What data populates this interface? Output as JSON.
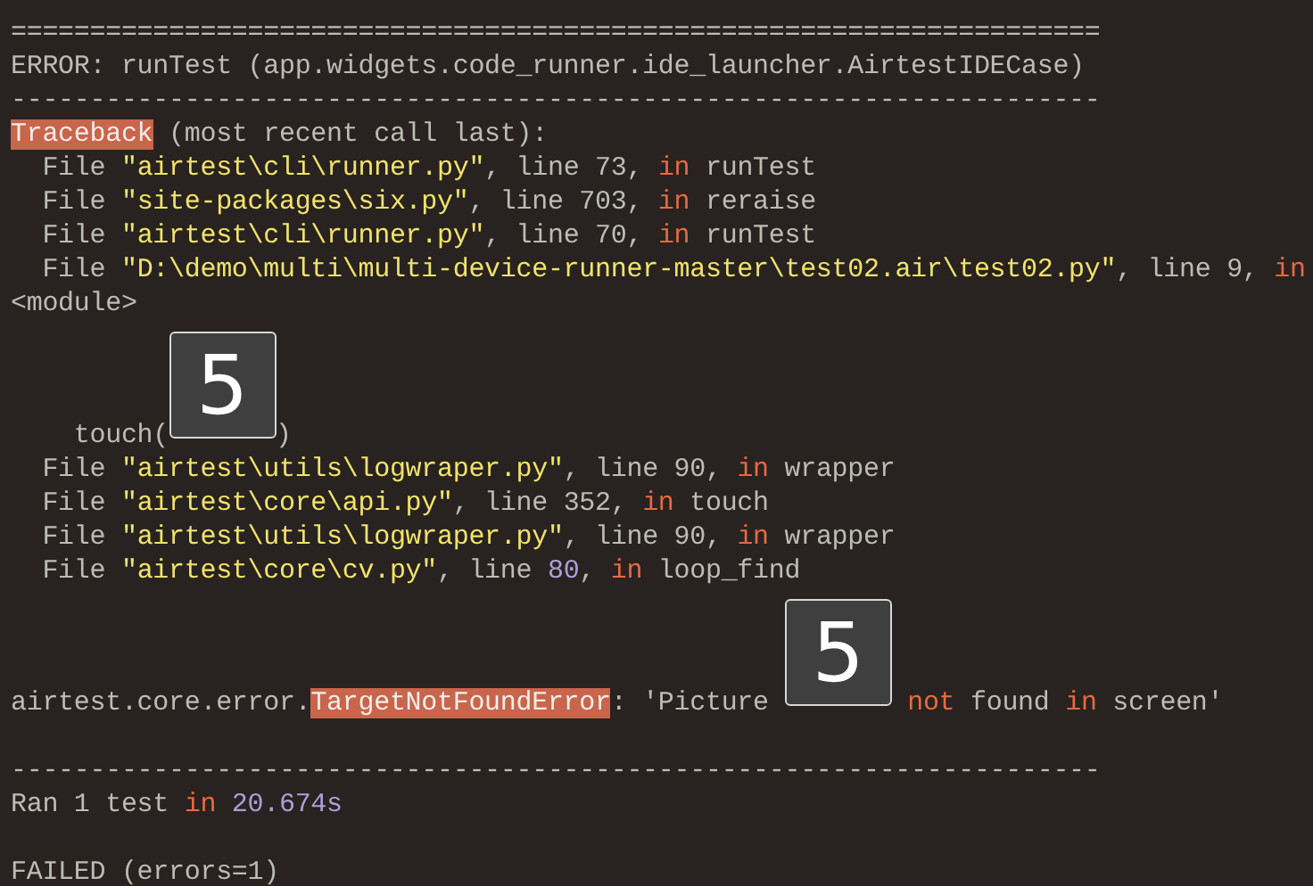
{
  "lines": [
    {
      "kind": "text",
      "segments": [
        {
          "kind": "plain",
          "text": "====================================================================="
        }
      ]
    },
    {
      "kind": "text",
      "segments": [
        {
          "kind": "plain",
          "text": "ERROR: runTest (app.widgets.code_runner.ide_launcher.AirtestIDECase)"
        }
      ]
    },
    {
      "kind": "text",
      "segments": [
        {
          "kind": "plain",
          "text": "---------------------------------------------------------------------"
        }
      ]
    },
    {
      "kind": "text",
      "segments": [
        {
          "kind": "highlight",
          "text": "Traceback"
        },
        {
          "kind": "plain",
          "text": " (most recent call last):"
        }
      ]
    },
    {
      "kind": "text",
      "segments": [
        {
          "kind": "plain",
          "text": "  File "
        },
        {
          "kind": "string",
          "text": "\"airtest\\cli\\runner.py\""
        },
        {
          "kind": "plain",
          "text": ", line 73, "
        },
        {
          "kind": "keyword",
          "text": "in"
        },
        {
          "kind": "plain",
          "text": " runTest"
        }
      ]
    },
    {
      "kind": "text",
      "segments": [
        {
          "kind": "plain",
          "text": "  File "
        },
        {
          "kind": "string",
          "text": "\"site-packages\\six.py\""
        },
        {
          "kind": "plain",
          "text": ", line 703, "
        },
        {
          "kind": "keyword",
          "text": "in"
        },
        {
          "kind": "plain",
          "text": " reraise"
        }
      ]
    },
    {
      "kind": "text",
      "segments": [
        {
          "kind": "plain",
          "text": "  File "
        },
        {
          "kind": "string",
          "text": "\"airtest\\cli\\runner.py\""
        },
        {
          "kind": "plain",
          "text": ", line 70, "
        },
        {
          "kind": "keyword",
          "text": "in"
        },
        {
          "kind": "plain",
          "text": " runTest"
        }
      ]
    },
    {
      "kind": "text",
      "segments": [
        {
          "kind": "plain",
          "text": "  File "
        },
        {
          "kind": "string",
          "text": "\"D:\\demo\\multi\\multi-device-runner-master\\test02.air\\test02.py\""
        },
        {
          "kind": "plain",
          "text": ", line 9, "
        },
        {
          "kind": "keyword",
          "text": "in"
        }
      ]
    },
    {
      "kind": "text",
      "segments": [
        {
          "kind": "plain",
          "text": "<module>"
        }
      ]
    },
    {
      "kind": "text",
      "segments": [
        {
          "kind": "plain",
          "text": "    touch("
        },
        {
          "kind": "image",
          "text": "5"
        },
        {
          "kind": "plain",
          "text": ")"
        }
      ]
    },
    {
      "kind": "text",
      "segments": [
        {
          "kind": "plain",
          "text": "  File "
        },
        {
          "kind": "string",
          "text": "\"airtest\\utils\\logwraper.py\""
        },
        {
          "kind": "plain",
          "text": ", line 90, "
        },
        {
          "kind": "keyword",
          "text": "in"
        },
        {
          "kind": "plain",
          "text": " wrapper"
        }
      ]
    },
    {
      "kind": "text",
      "segments": [
        {
          "kind": "plain",
          "text": "  File "
        },
        {
          "kind": "string",
          "text": "\"airtest\\core\\api.py\""
        },
        {
          "kind": "plain",
          "text": ", line 352, "
        },
        {
          "kind": "keyword",
          "text": "in"
        },
        {
          "kind": "plain",
          "text": " touch"
        }
      ]
    },
    {
      "kind": "text",
      "segments": [
        {
          "kind": "plain",
          "text": "  File "
        },
        {
          "kind": "string",
          "text": "\"airtest\\utils\\logwraper.py\""
        },
        {
          "kind": "plain",
          "text": ", line 90, "
        },
        {
          "kind": "keyword",
          "text": "in"
        },
        {
          "kind": "plain",
          "text": " wrapper"
        }
      ]
    },
    {
      "kind": "text",
      "segments": [
        {
          "kind": "plain",
          "text": "  File "
        },
        {
          "kind": "string",
          "text": "\"airtest\\core\\cv.py\""
        },
        {
          "kind": "plain",
          "text": ", line "
        },
        {
          "kind": "number",
          "text": "80"
        },
        {
          "kind": "plain",
          "text": ", "
        },
        {
          "kind": "keyword",
          "text": "in"
        },
        {
          "kind": "plain",
          "text": " loop_find"
        }
      ]
    },
    {
      "kind": "text",
      "segments": [
        {
          "kind": "plain",
          "text": "airtest.core.error."
        },
        {
          "kind": "highlight",
          "text": "TargetNotFoundError"
        },
        {
          "kind": "plain",
          "text": ": 'Picture "
        },
        {
          "kind": "image",
          "text": "5"
        },
        {
          "kind": "keyword",
          "text": " not"
        },
        {
          "kind": "plain",
          "text": " found "
        },
        {
          "kind": "keyword",
          "text": "in"
        },
        {
          "kind": "plain",
          "text": " screen'"
        }
      ]
    },
    {
      "kind": "blank"
    },
    {
      "kind": "text",
      "segments": [
        {
          "kind": "plain",
          "text": "---------------------------------------------------------------------"
        }
      ]
    },
    {
      "kind": "text",
      "segments": [
        {
          "kind": "plain",
          "text": "Ran 1 test "
        },
        {
          "kind": "keyword",
          "text": "in"
        },
        {
          "kind": "number",
          "text": " 20.674s"
        }
      ]
    },
    {
      "kind": "blank"
    },
    {
      "kind": "text",
      "segments": [
        {
          "kind": "plain",
          "text": "FAILED (errors=1)"
        }
      ]
    }
  ]
}
